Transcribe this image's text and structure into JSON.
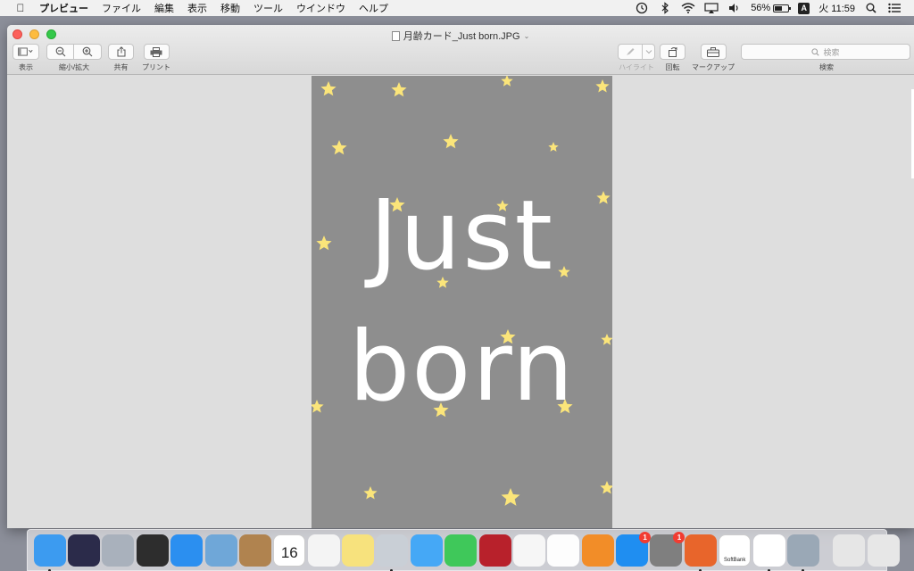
{
  "menubar": {
    "app_name": "プレビュー",
    "items": [
      "ファイル",
      "編集",
      "表示",
      "移動",
      "ツール",
      "ウインドウ",
      "ヘルプ"
    ],
    "status": {
      "battery_percent": "56%",
      "battery_level": 0.56,
      "input_source": "A",
      "clock": "火 11:59"
    }
  },
  "window": {
    "title": "月齢カード_Just born.JPG",
    "toolbar": {
      "view_label": "表示",
      "zoom_label": "縮小/拡大",
      "share_label": "共有",
      "print_label": "プリント",
      "highlight_label": "ハイライト",
      "rotate_label": "回転",
      "markup_label": "マークアップ",
      "search_label": "検索",
      "search_placeholder": "検索"
    }
  },
  "image": {
    "line1": "Just",
    "line2": "born",
    "background_color": "#8e8e8e",
    "star_color": "#fbe57a"
  },
  "dock": {
    "apps": [
      {
        "name": "Finder",
        "icon": "finder-icon",
        "color": "#3c9bf0",
        "running": true
      },
      {
        "name": "Siri",
        "icon": "siri-icon",
        "color": "#2b2b4a"
      },
      {
        "name": "Launchpad",
        "icon": "launchpad-icon",
        "color": "#a9b1bc"
      },
      {
        "name": "Mission Control",
        "icon": "mission-control-icon",
        "color": "#2d2d2d"
      },
      {
        "name": "Safari",
        "icon": "safari-icon",
        "color": "#2b8ff0"
      },
      {
        "name": "Mail",
        "icon": "mail-icon",
        "color": "#6fa7d8"
      },
      {
        "name": "Contacts",
        "icon": "contacts-icon",
        "color": "#b0834f"
      },
      {
        "name": "Calendar",
        "icon": "calendar-icon",
        "color": "#ffffff",
        "day": "16"
      },
      {
        "name": "Reminders",
        "icon": "reminders-icon",
        "color": "#f4f4f4"
      },
      {
        "name": "Notes",
        "icon": "notes-icon",
        "color": "#f7e27d"
      },
      {
        "name": "Preview",
        "icon": "preview-icon",
        "color": "#c9cfd6",
        "running": true
      },
      {
        "name": "Messages",
        "icon": "messages-icon",
        "color": "#45a8f6"
      },
      {
        "name": "FaceTime",
        "icon": "facetime-icon",
        "color": "#3fc85a"
      },
      {
        "name": "Photo Booth",
        "icon": "photo-booth-icon",
        "color": "#b8212b"
      },
      {
        "name": "Photos",
        "icon": "photos-icon",
        "color": "#f6f6f6"
      },
      {
        "name": "iTunes",
        "icon": "itunes-icon",
        "color": "#fdfdfd"
      },
      {
        "name": "iBooks",
        "icon": "ibooks-icon",
        "color": "#f28d28"
      },
      {
        "name": "App Store",
        "icon": "app-store-icon",
        "color": "#1f8ef1",
        "badge": "1"
      },
      {
        "name": "System Preferences",
        "icon": "system-preferences-icon",
        "color": "#7f7f7f",
        "badge": "1"
      },
      {
        "name": "Firefox",
        "icon": "firefox-icon",
        "color": "#e8652b",
        "running": true
      },
      {
        "name": "SoftBank",
        "icon": "softbank-icon",
        "color": "#ffffff",
        "label": "SoftBank"
      },
      {
        "name": "Chrome",
        "icon": "chrome-icon",
        "color": "#ffffff",
        "running": true
      },
      {
        "name": "Image Capture",
        "icon": "image-capture-icon",
        "color": "#9aa8b6",
        "running": true
      }
    ],
    "trailing": [
      {
        "name": "Downloads",
        "icon": "downloads-stack-icon",
        "color": "#e6e6e6"
      },
      {
        "name": "Trash",
        "icon": "trash-icon",
        "color": "#e7e7e7"
      }
    ]
  }
}
